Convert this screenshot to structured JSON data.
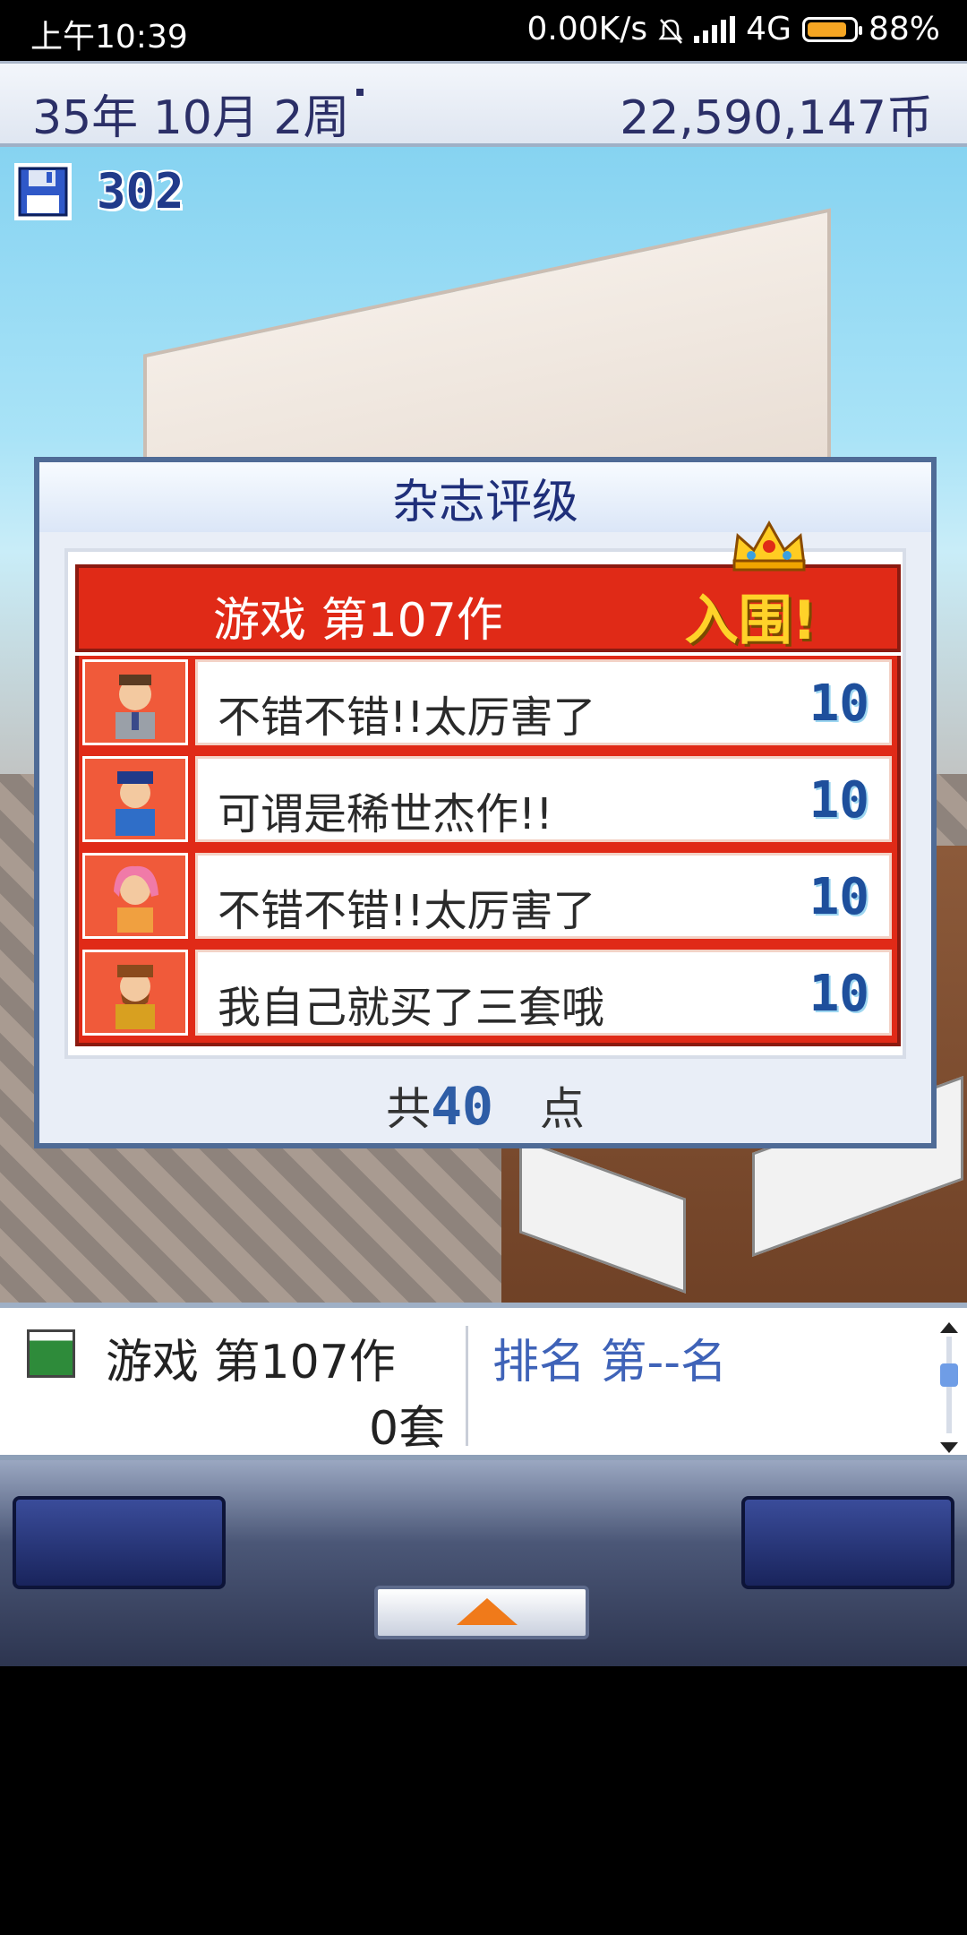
{
  "status": {
    "time": "上午10:39",
    "network": "0.00K/s",
    "signal": "4G",
    "battery": "88%",
    "battery_level": 0.88
  },
  "header": {
    "date": "35年 10月 2周",
    "money": "22,590,147币"
  },
  "save": {
    "count": "302",
    "icon": "floppy-disk-icon"
  },
  "dialog": {
    "title": "杂志评级",
    "game_title": "游戏 第107作",
    "award": "入围!",
    "reviews": [
      {
        "comment": "不错不错!!太厉害了",
        "score": "10"
      },
      {
        "comment": "可谓是稀世杰作!!",
        "score": "10"
      },
      {
        "comment": "不错不错!!太厉害了",
        "score": "10"
      },
      {
        "comment": "我自己就买了三套哦",
        "score": "10"
      }
    ],
    "total_prefix": "共",
    "total_value": "40",
    "total_suffix": "点"
  },
  "info": {
    "game_name": "游戏 第107作",
    "sold": "0套",
    "rank": "排名 第--名"
  },
  "colors": {
    "accent_red": "#e02a17",
    "score_blue": "#1e4f9c",
    "award_yellow": "#ffd229"
  }
}
